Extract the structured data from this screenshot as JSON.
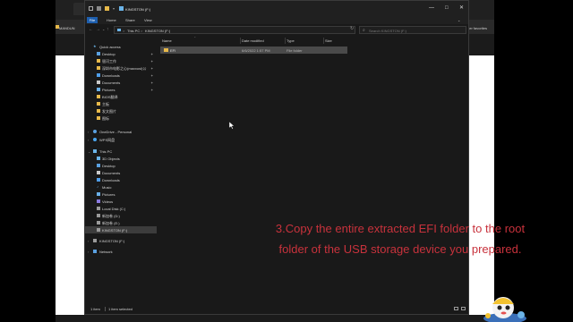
{
  "browser": {
    "left_bookmark": "MANDUN",
    "right_bookmark": "her favorites"
  },
  "explorer": {
    "title": "KINGSTON (F:)",
    "window_controls": {
      "minimize": "—",
      "maximize": "□",
      "close": "✕"
    },
    "ribbon_tabs": [
      "File",
      "Home",
      "Share",
      "View"
    ],
    "address": {
      "crumbs": [
        "This PC",
        "KINGSTON (F:)"
      ],
      "separator": ">"
    },
    "search_placeholder": "Search KINGSTON (F:)",
    "nav": {
      "quick_access_label": "Quick access",
      "quick_access": [
        "Desktop",
        "银河工作",
        "深圳市电影之心(maxxusi)公",
        "Downloads",
        "Documents",
        "Pictures",
        "BIOS翻译",
        "主板",
        "发文图片",
        "图标"
      ],
      "onedrive": "OneDrive - Personal",
      "wps": "WPS网盘",
      "this_pc_label": "This PC",
      "this_pc": [
        "3D Objects",
        "Desktop",
        "Documents",
        "Downloads",
        "Music",
        "Pictures",
        "Videos",
        "Local Disk (C:)",
        "新加卷 (D:)",
        "新加卷 (E:)",
        "KINGSTON (F:)"
      ],
      "usb_drive": "KINGSTON (F:)",
      "network": "Network"
    },
    "columns": [
      "Name",
      "Date modified",
      "Type",
      "Size"
    ],
    "rows": [
      {
        "name": "EFI",
        "date": "6/6/2022 1:57 PM",
        "type": "File folder",
        "size": ""
      }
    ],
    "status": {
      "count": "1 item",
      "selected": "1 item selected"
    }
  },
  "caption_lines": [
    "3.Copy the entire extracted EFI folder to the root",
    "folder of the USB storage device you prepared."
  ],
  "colors": {
    "caption": "#c8323c",
    "folder": "#e7b94a",
    "selection": "#4a4a4a",
    "accent_tab": "#1e5fae"
  }
}
